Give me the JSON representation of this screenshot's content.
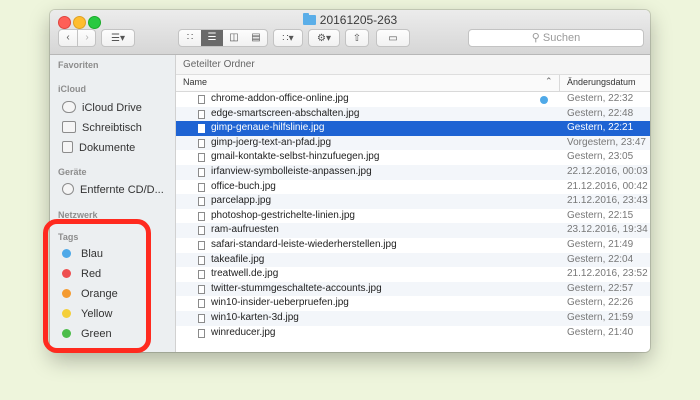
{
  "window": {
    "title": "20161205-263",
    "search_placeholder": "Suchen"
  },
  "sidebar": {
    "favorites_heading": "Favoriten",
    "icloud_heading": "iCloud",
    "icloud_items": [
      {
        "label": "iCloud Drive",
        "icon": "cloud-icon"
      },
      {
        "label": "Schreibtisch",
        "icon": "desktop-icon"
      },
      {
        "label": "Dokumente",
        "icon": "documents-icon"
      }
    ],
    "devices_heading": "Geräte",
    "device_items": [
      {
        "label": "Entfernte CD/D...",
        "icon": "disc-icon"
      }
    ],
    "network_heading": "Netzwerk",
    "tags_heading": "Tags",
    "tags": [
      {
        "label": "Blau",
        "color": "#4fa9e8"
      },
      {
        "label": "Red",
        "color": "#ee4f4f"
      },
      {
        "label": "Orange",
        "color": "#f49b31"
      },
      {
        "label": "Yellow",
        "color": "#f4cf3a"
      },
      {
        "label": "Green",
        "color": "#4cbd4a"
      }
    ]
  },
  "content": {
    "section_title": "Geteilter Ordner",
    "columns": {
      "name": "Name",
      "date": "Änderungsdatum"
    },
    "selected_index": 2,
    "files": [
      {
        "name": "chrome-addon-office-online.jpg",
        "date": "Gestern, 22:32",
        "tag": "#4fa9e8"
      },
      {
        "name": "edge-smartscreen-abschalten.jpg",
        "date": "Gestern, 22:48"
      },
      {
        "name": "gimp-genaue-hilfslinie.jpg",
        "date": "Gestern, 22:21"
      },
      {
        "name": "gimp-joerg-text-an-pfad.jpg",
        "date": "Vorgestern, 23:47"
      },
      {
        "name": "gmail-kontakte-selbst-hinzufuegen.jpg",
        "date": "Gestern, 23:05"
      },
      {
        "name": "irfanview-symbolleiste-anpassen.jpg",
        "date": "22.12.2016, 00:03"
      },
      {
        "name": "office-buch.jpg",
        "date": "21.12.2016, 00:42"
      },
      {
        "name": "parcelapp.jpg",
        "date": "21.12.2016, 23:43"
      },
      {
        "name": "photoshop-gestrichelte-linien.jpg",
        "date": "Gestern, 22:15"
      },
      {
        "name": "ram-aufruesten",
        "date": "23.12.2016, 19:34"
      },
      {
        "name": "safari-standard-leiste-wiederherstellen.jpg",
        "date": "Gestern, 21:49"
      },
      {
        "name": "takeafile.jpg",
        "date": "Gestern, 22:04"
      },
      {
        "name": "treatwell.de.jpg",
        "date": "21.12.2016, 23:52"
      },
      {
        "name": "twitter-stummgeschaltete-accounts.jpg",
        "date": "Gestern, 22:57"
      },
      {
        "name": "win10-insider-ueberpruefen.jpg",
        "date": "Gestern, 22:26"
      },
      {
        "name": "win10-karten-3d.jpg",
        "date": "Gestern, 21:59"
      },
      {
        "name": "winreducer.jpg",
        "date": "Gestern, 21:40"
      }
    ]
  }
}
